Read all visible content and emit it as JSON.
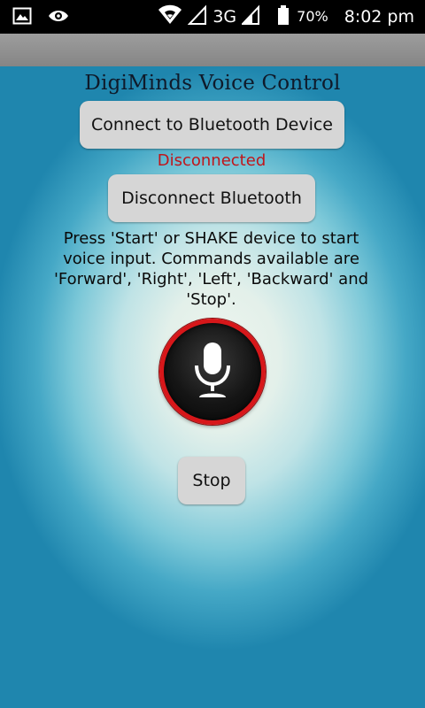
{
  "status_bar": {
    "network": "3G",
    "battery_percent": "70%",
    "time": "8:02 pm",
    "icons": [
      "image-icon",
      "eye-icon",
      "wifi-icon",
      "signal-empty-icon",
      "signal-icon",
      "battery-icon"
    ]
  },
  "app": {
    "title": "DigiMinds Voice Control"
  },
  "buttons": {
    "connect_label": "Connect to Bluetooth Device",
    "disconnect_label": "Disconnect Bluetooth",
    "stop_label": "Stop"
  },
  "connection": {
    "status": "Disconnected",
    "status_color": "#c0161b"
  },
  "instructions": "Press 'Start' or SHAKE device to start voice input. Commands available are 'Forward', 'Right', 'Left', 'Backward' and 'Stop'.",
  "mic": {
    "icon": "microphone-icon",
    "ring_color": "#d7171a"
  }
}
